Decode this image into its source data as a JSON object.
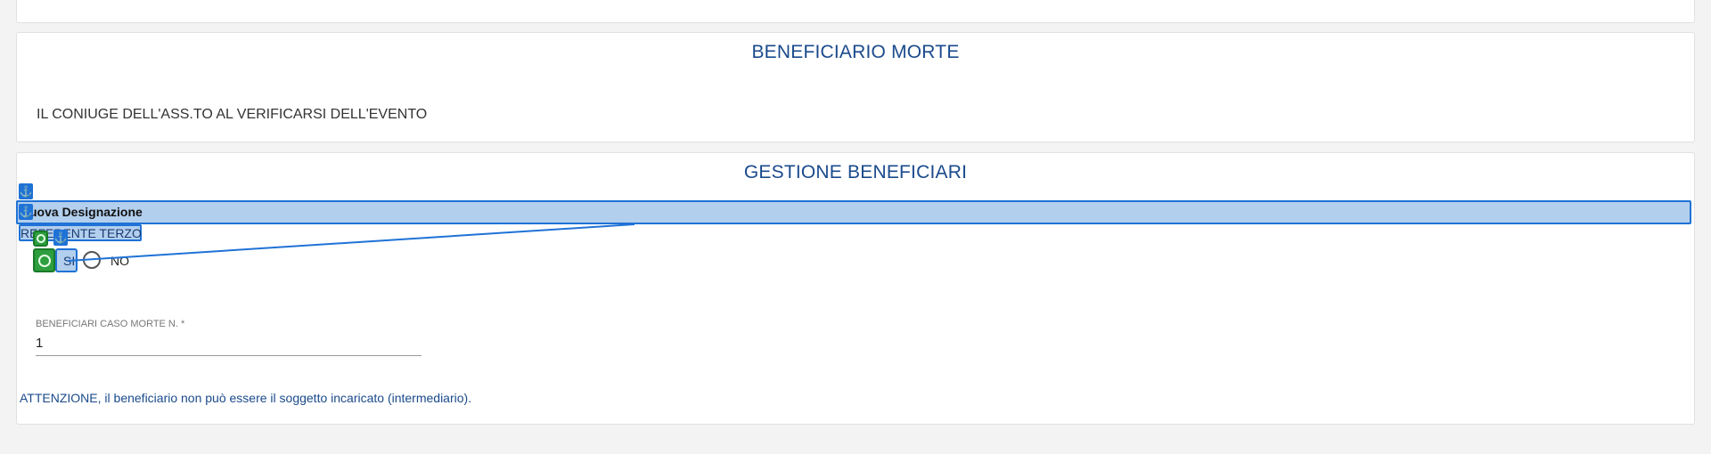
{
  "beneficiario_morte": {
    "title": "BENEFICIARIO MORTE",
    "text": "IL CONIUGE DELL'ASS.TO AL VERIFICARSI DELL'EVENTO"
  },
  "gestione_beneficiari": {
    "title": "GESTIONE BENEFICIARI",
    "nuova_designazione_label": "uova Designazione",
    "referente_terzo_label": "REFERENTE TERZO",
    "radio": {
      "si_label": "SI",
      "no_label": "NO"
    },
    "beneficiari_field": {
      "label": "BENEFICIARI CASO MORTE N. *",
      "value": "1"
    },
    "warning": {
      "strong": "ATTENZIONE",
      "text": ", il beneficiario non può essere il soggetto incaricato (intermediario)."
    }
  },
  "colors": {
    "title": "#1a4a8c",
    "highlight": "#b3cfee",
    "highlight_border": "#1f72d6",
    "target_green": "#2e9e3e"
  },
  "icons": [
    "anchor-icon",
    "target-icon"
  ]
}
